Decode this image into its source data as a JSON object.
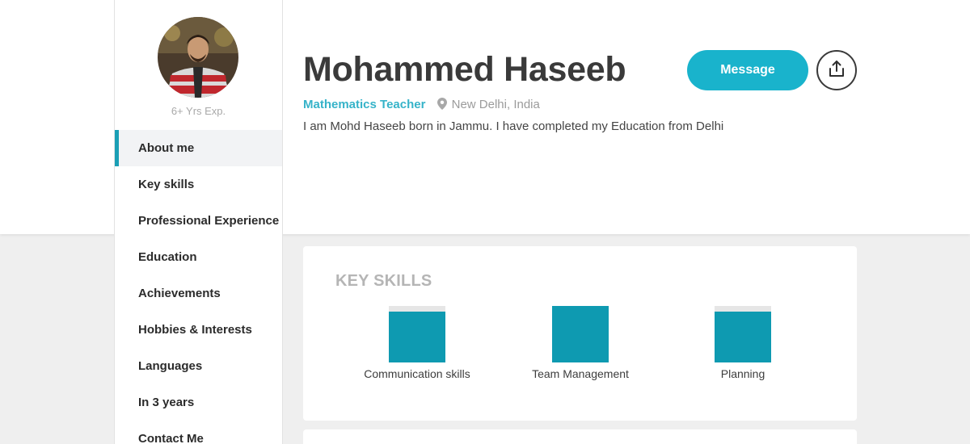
{
  "profile": {
    "name": "Mohammed Haseeb",
    "role": "Mathematics Teacher",
    "location": "New Delhi, India",
    "bio": "I am Mohd Haseeb born in Jammu. I have completed my Education from Delhi",
    "experience": "6+ Yrs Exp."
  },
  "actions": {
    "message_label": "Message",
    "share_icon": "share-upload-icon"
  },
  "sidebar": {
    "items": [
      {
        "label": "About me",
        "active": true
      },
      {
        "label": "Key skills"
      },
      {
        "label": "Professional Experience"
      },
      {
        "label": "Education"
      },
      {
        "label": "Achievements"
      },
      {
        "label": "Hobbies & Interests"
      },
      {
        "label": "Languages"
      },
      {
        "label": "In 3 years"
      },
      {
        "label": "Contact Me"
      }
    ]
  },
  "key_skills": {
    "title": "KEY SKILLS",
    "accent_color": "#0e9ab1",
    "skills": [
      {
        "label": "Communication skills",
        "level": 0.9
      },
      {
        "label": "Team Management",
        "level": 1.0
      },
      {
        "label": "Planning",
        "level": 0.9
      }
    ]
  },
  "colors": {
    "accent": "#19b3cc",
    "active_nav_border": "#1a9fb5"
  }
}
